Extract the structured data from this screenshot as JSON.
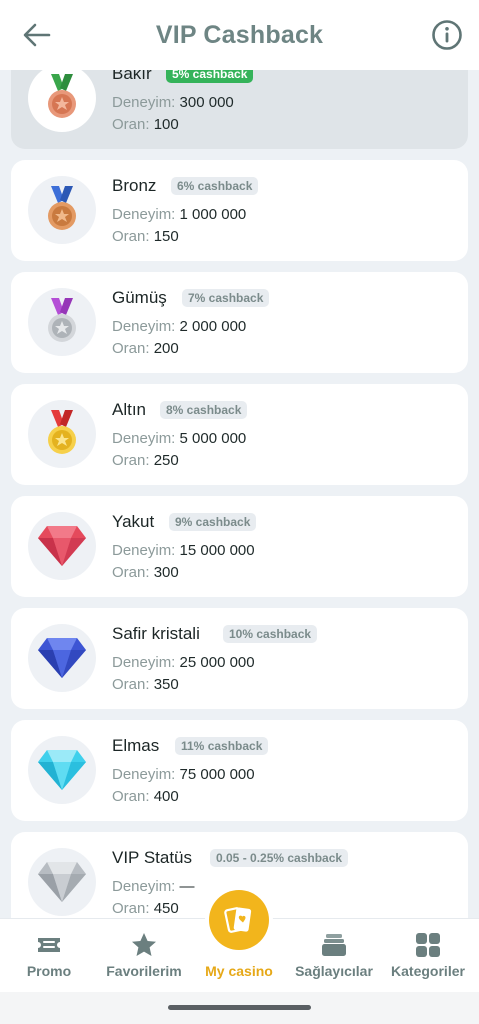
{
  "header": {
    "title": "VIP Cashback",
    "back_icon": "arrow-left-icon",
    "info_icon": "info-circle-icon"
  },
  "labels": {
    "experience": "Deneyim:",
    "rate": "Oran:"
  },
  "levels": [
    {
      "name": "Bakır",
      "cashback": "5% cashback",
      "experience": "300 000",
      "rate": "100",
      "icon": "copper-medal-icon",
      "current": true
    },
    {
      "name": "Bronz",
      "cashback": "6% cashback",
      "experience": "1 000 000",
      "rate": "150",
      "icon": "bronze-medal-icon"
    },
    {
      "name": "Gümüş",
      "cashback": "7% cashback",
      "experience": "2 000 000",
      "rate": "200",
      "icon": "silver-medal-icon"
    },
    {
      "name": "Altın",
      "cashback": "8% cashback",
      "experience": "5 000 000",
      "rate": "250",
      "icon": "gold-medal-icon"
    },
    {
      "name": "Yakut",
      "cashback": "9% cashback",
      "experience": "15 000 000",
      "rate": "300",
      "icon": "ruby-gem-icon"
    },
    {
      "name": "Safir kristali",
      "cashback": "10% cashback",
      "experience": "25 000 000",
      "rate": "350",
      "icon": "sapphire-gem-icon"
    },
    {
      "name": "Elmas",
      "cashback": "11% cashback",
      "experience": "75 000 000",
      "rate": "400",
      "icon": "diamond-gem-icon"
    },
    {
      "name": "VIP Statüs",
      "cashback": "0.05 - 0.25% cashback",
      "experience": "—",
      "rate": "450",
      "icon": "vip-diamond-icon"
    }
  ],
  "bottom_nav": [
    {
      "label": "Promo",
      "icon": "ticket-icon"
    },
    {
      "label": "Favorilerim",
      "icon": "star-icon"
    },
    {
      "label": "My casino",
      "icon": "cards-icon",
      "active": true
    },
    {
      "label": "Sağlayıcılar",
      "icon": "stacked-cards-icon"
    },
    {
      "label": "Kategoriler",
      "icon": "grid-icon"
    }
  ],
  "colors": {
    "accent": "#f2b51c",
    "current_badge": "#35b35a",
    "title": "#6e8584"
  }
}
